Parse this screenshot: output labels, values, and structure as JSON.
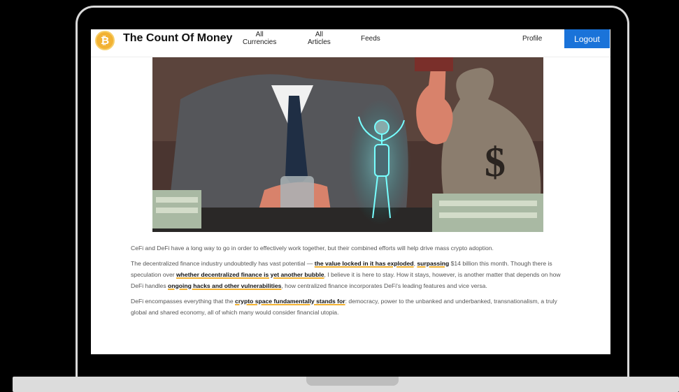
{
  "navbar": {
    "brand": "The Count Of Money",
    "links": [
      {
        "line1": "All",
        "line2": "Currencies"
      },
      {
        "line1": "All",
        "line2": "Articles"
      },
      {
        "line1": "Feeds",
        "line2": ""
      }
    ],
    "profile": "Profile",
    "logout": "Logout"
  },
  "article": {
    "p1": "CeFi and DeFi have a long way to go in order to effectively work together, but their combined efforts will help drive mass crypto adoption.",
    "p2": {
      "a": "The decentralized finance industry undoubtedly has vast potential — ",
      "link1": "the value locked in it has exploded",
      "b": ", ",
      "link2": "surpassing",
      "c": " $14 billion this month. Though there is speculation over ",
      "link3": "whether decentralized finance is yet another bubble",
      "d": ", I believe it is here to stay. How it stays, however, is another matter that depends on how DeFi handles ",
      "link4": "ongoing hacks and other vulnerabilities",
      "e": ", how centralized finance incorporates DeFi's leading features and vice versa."
    },
    "p3": {
      "a": "DeFi encompasses everything that the ",
      "link1": "crypto space fundamentally stands for",
      "b": ": democracy, power to the unbanked and underbanked, transnationalism, a truly global and shared economy, all of which many would consider financial utopia."
    }
  },
  "colors": {
    "accent": "#1a73d9",
    "highlight": "#f2b233"
  }
}
